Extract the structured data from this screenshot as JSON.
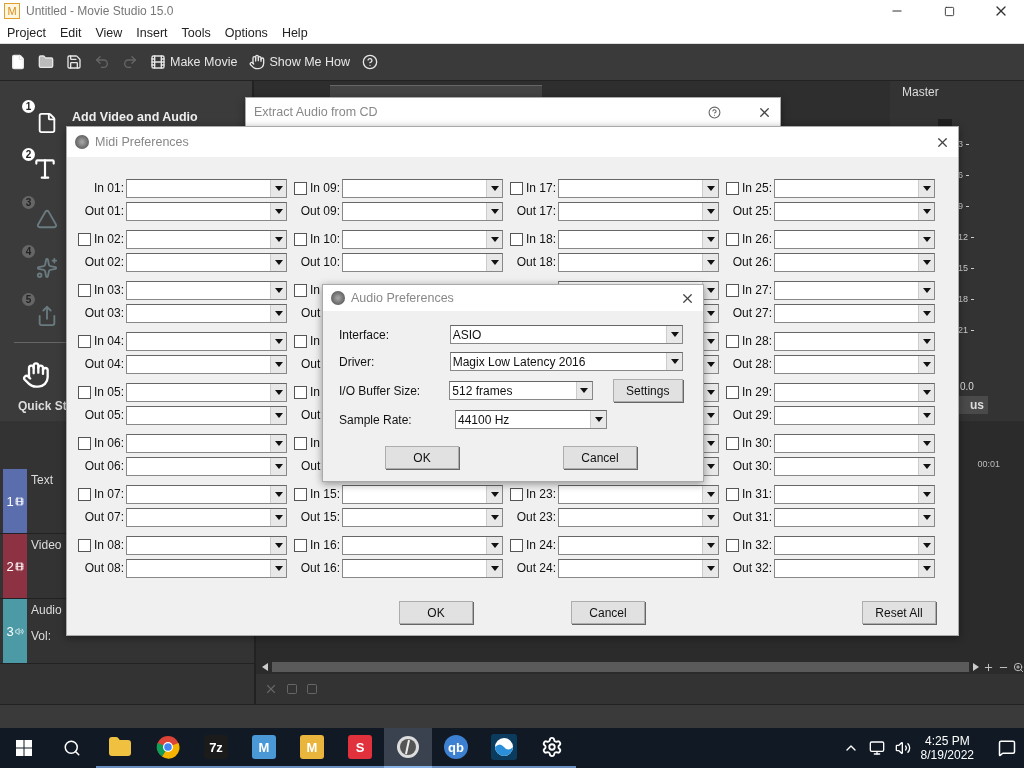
{
  "app": {
    "logo": "M",
    "title": "Untitled - Movie Studio 15.0",
    "menu": [
      "Project",
      "Edit",
      "View",
      "Insert",
      "Tools",
      "Options",
      "Help"
    ],
    "toolbar": [
      {
        "kind": "new"
      },
      {
        "kind": "open"
      },
      {
        "kind": "save"
      },
      {
        "kind": "undo",
        "disabled": true
      },
      {
        "kind": "redo",
        "disabled": true
      },
      {
        "kind": "movie",
        "label": "Make Movie"
      },
      {
        "kind": "howto",
        "label": "Show Me How"
      },
      {
        "kind": "help"
      }
    ]
  },
  "quick_start": {
    "steps": [
      {
        "number": "1",
        "kind": "media",
        "title": "Add Video and Audio",
        "disabled": false
      },
      {
        "number": "2",
        "kind": "text",
        "disabled": false
      },
      {
        "number": "3",
        "kind": "transition",
        "disabled": true
      },
      {
        "number": "4",
        "kind": "fx",
        "disabled": true
      },
      {
        "number": "5",
        "kind": "export",
        "disabled": true
      }
    ],
    "footer": "Quick St"
  },
  "mixer": {
    "title": "Master",
    "scale": [
      "3",
      "6",
      "9",
      "12",
      "15",
      "18",
      "21"
    ],
    "reading": "0.0",
    "bus_button": "us"
  },
  "tracks": [
    {
      "number": "1",
      "kind": "video",
      "name": "Text",
      "color": "#5a6eae"
    },
    {
      "number": "2",
      "kind": "video",
      "name": "Video",
      "color": "#8c3243"
    },
    {
      "number": "3",
      "kind": "audio",
      "name": "Audio",
      "color": "#4c9aa6",
      "volume_label": "Vol:"
    }
  ],
  "timeline": {
    "time": "00:01"
  },
  "extract_dialog": {
    "title": "Extract Audio from CD"
  },
  "midi_dialog": {
    "title": "Midi Preferences",
    "columns": [
      [
        {
          "kind": "full",
          "in": "In 01:",
          "out": "Out 01:"
        },
        {
          "kind": "full",
          "checked": false,
          "in": "In 02:",
          "out": "Out 02:"
        },
        {
          "kind": "full",
          "checked": false,
          "in": "In 03:",
          "out": "Out 03:"
        },
        {
          "kind": "full",
          "checked": false,
          "in": "In 04:",
          "out": "Out 04:"
        },
        {
          "kind": "full",
          "checked": false,
          "in": "In 05:",
          "out": "Out 05:"
        },
        {
          "kind": "full",
          "checked": false,
          "in": "In 06:",
          "out": "Out 06:"
        },
        {
          "kind": "full",
          "checked": false,
          "in": "In 07:",
          "out": "Out 07:"
        },
        {
          "kind": "full",
          "checked": false,
          "in": "In 08:",
          "out": "Out 08:"
        }
      ],
      [
        {
          "kind": "full",
          "checked": false,
          "in": "In 09:",
          "out": "Out 09:"
        },
        {
          "kind": "full",
          "checked": false,
          "in": "In 10:",
          "out": "Out 10:"
        },
        {
          "kind": "label-only",
          "checked": false,
          "in": "In",
          "out": "Out"
        },
        {
          "kind": "label-only",
          "checked": false,
          "in": "In",
          "out": "Out"
        },
        {
          "kind": "label-only",
          "checked": false,
          "in": "In",
          "out": "Out"
        },
        {
          "kind": "label-only",
          "checked": false,
          "in": "In",
          "out": "Out"
        },
        {
          "kind": "full",
          "checked": false,
          "in": "In 15:",
          "out": "Out 15:"
        },
        {
          "kind": "full",
          "checked": false,
          "in": "In 16:",
          "out": "Out 16:"
        }
      ],
      [
        {
          "kind": "full",
          "checked": false,
          "in": "In 17:",
          "out": "Out 17:"
        },
        {
          "kind": "full",
          "checked": false,
          "in": "In 18:",
          "out": "Out 18:"
        },
        {
          "kind": "combo-only"
        },
        {
          "kind": "combo-only"
        },
        {
          "kind": "combo-only"
        },
        {
          "kind": "combo-only"
        },
        {
          "kind": "full",
          "checked": false,
          "in": "In 23:",
          "out": "Out 23:"
        },
        {
          "kind": "full",
          "checked": false,
          "in": "In 24:",
          "out": "Out 24:"
        }
      ],
      [
        {
          "kind": "full",
          "checked": false,
          "in": "In 25:",
          "out": "Out 25:"
        },
        {
          "kind": "full",
          "checked": false,
          "in": "In 26:",
          "out": "Out 26:"
        },
        {
          "kind": "full",
          "checked": false,
          "in": "In 27:",
          "out": "Out 27:"
        },
        {
          "kind": "full",
          "checked": false,
          "in": "In 28:",
          "out": "Out 28:"
        },
        {
          "kind": "full",
          "checked": false,
          "in": "In 29:",
          "out": "Out 29:"
        },
        {
          "kind": "full",
          "checked": false,
          "in": "In 30:",
          "out": "Out 30:"
        },
        {
          "kind": "full",
          "checked": false,
          "in": "In 31:",
          "out": "Out 31:"
        },
        {
          "kind": "full",
          "checked": false,
          "in": "In 32:",
          "out": "Out 32:"
        }
      ]
    ],
    "buttons": [
      "OK",
      "Cancel",
      "Reset All"
    ]
  },
  "audio_dialog": {
    "title": "Audio Preferences",
    "fields": [
      {
        "label": "Interface:",
        "value": "ASIO",
        "kind": "wide"
      },
      {
        "label": "Driver:",
        "value": "Magix Low Latency 2016",
        "kind": "wide"
      },
      {
        "label": "I/O Buffer Size:",
        "value": "512 frames",
        "kind": "short",
        "button": "Settings"
      },
      {
        "label": "Sample Rate:",
        "value": "44100 Hz",
        "kind": "short"
      }
    ],
    "buttons": [
      "OK",
      "Cancel"
    ]
  },
  "taskbar": {
    "apps": [
      {
        "kind": "folder",
        "selected": false
      },
      {
        "kind": "chrome",
        "selected": false
      },
      {
        "kind": "badge",
        "label": "7z",
        "color": "#1b1b1b",
        "selected": false
      },
      {
        "kind": "badge",
        "label": "M",
        "color": "#4a98d6",
        "selected": false
      },
      {
        "kind": "badge",
        "label": "M",
        "color": "#e9b53c",
        "selected": false
      },
      {
        "kind": "badge",
        "label": "S",
        "color": "#e0313d",
        "selected": false
      },
      {
        "kind": "studio",
        "selected": true
      },
      {
        "kind": "round",
        "label": "qb",
        "color": "#3d7fd1",
        "selected": false
      },
      {
        "kind": "wave",
        "selected": false
      },
      {
        "kind": "gear",
        "selected": false
      }
    ],
    "time": "4:25 PM",
    "date": "8/19/2022"
  }
}
